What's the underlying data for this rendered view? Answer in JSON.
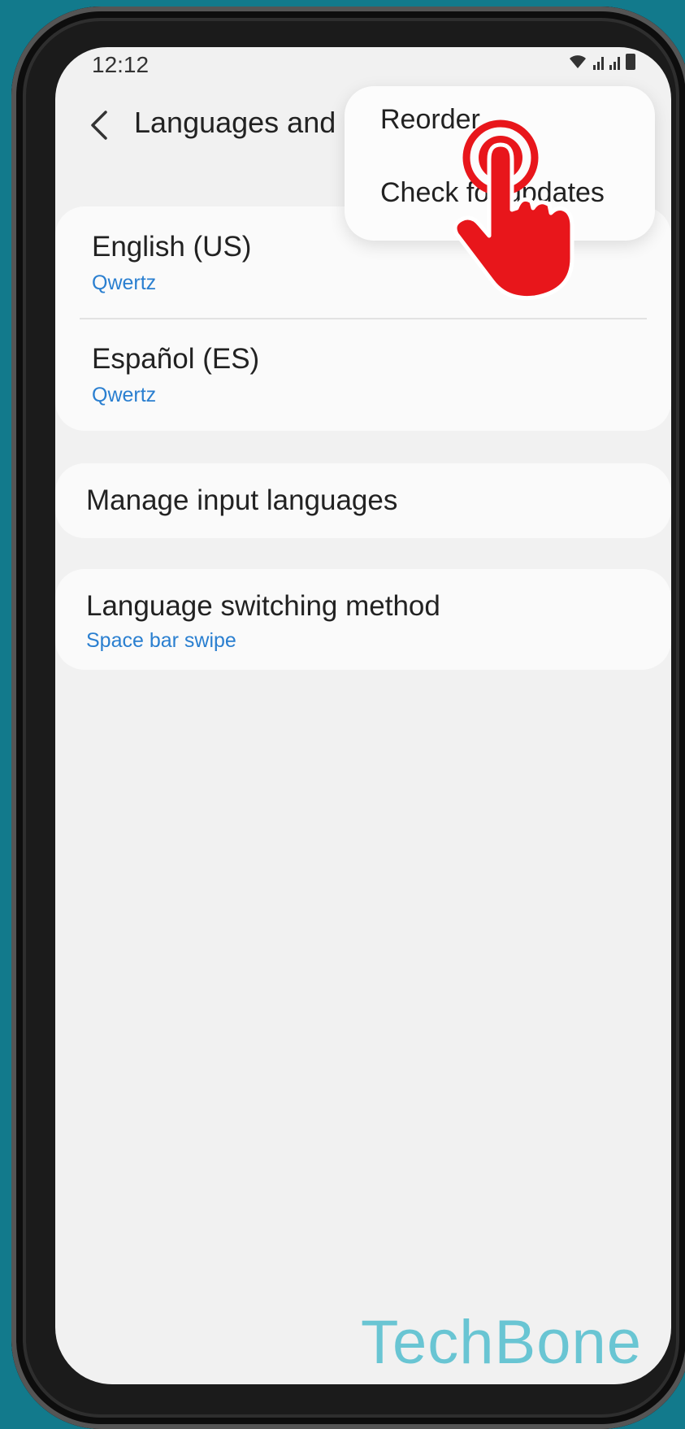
{
  "status_bar": {
    "time": "12:12"
  },
  "header": {
    "title": "Languages and"
  },
  "languages": [
    {
      "name": "English (US)",
      "layout": "Qwertz"
    },
    {
      "name": "Español (ES)",
      "layout": "Qwertz"
    }
  ],
  "manage": {
    "label": "Manage input languages"
  },
  "switching": {
    "label": "Language switching method",
    "value": "Space bar swipe"
  },
  "menu": {
    "items": [
      {
        "label": "Reorder"
      },
      {
        "label": "Check for updates"
      }
    ]
  },
  "watermark": "TechBone",
  "colors": {
    "accent": "#2a7fd0",
    "tap_indicator": "#e8161b",
    "background": "#127a8c"
  }
}
